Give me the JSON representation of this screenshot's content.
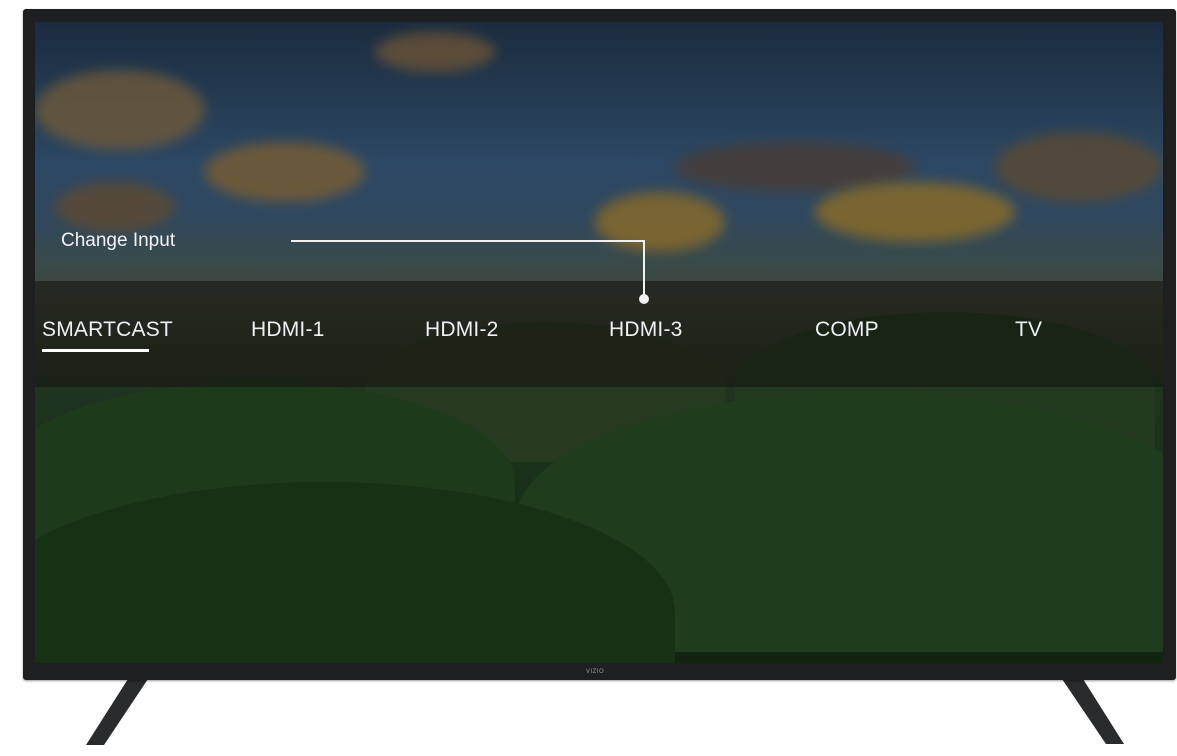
{
  "callout": {
    "label": "Change Input"
  },
  "inputs": [
    {
      "label": "SMARTCAST",
      "selected": true
    },
    {
      "label": "HDMI-1",
      "selected": false
    },
    {
      "label": "HDMI-2",
      "selected": false
    },
    {
      "label": "HDMI-3",
      "selected": false
    },
    {
      "label": "COMP",
      "selected": false
    },
    {
      "label": "TV",
      "selected": false
    }
  ],
  "tv": {
    "logo": "VIZIO"
  },
  "colors": {
    "text": "#eef1f3",
    "bezel": "#1e1f21",
    "highlight": "#ffffff"
  }
}
